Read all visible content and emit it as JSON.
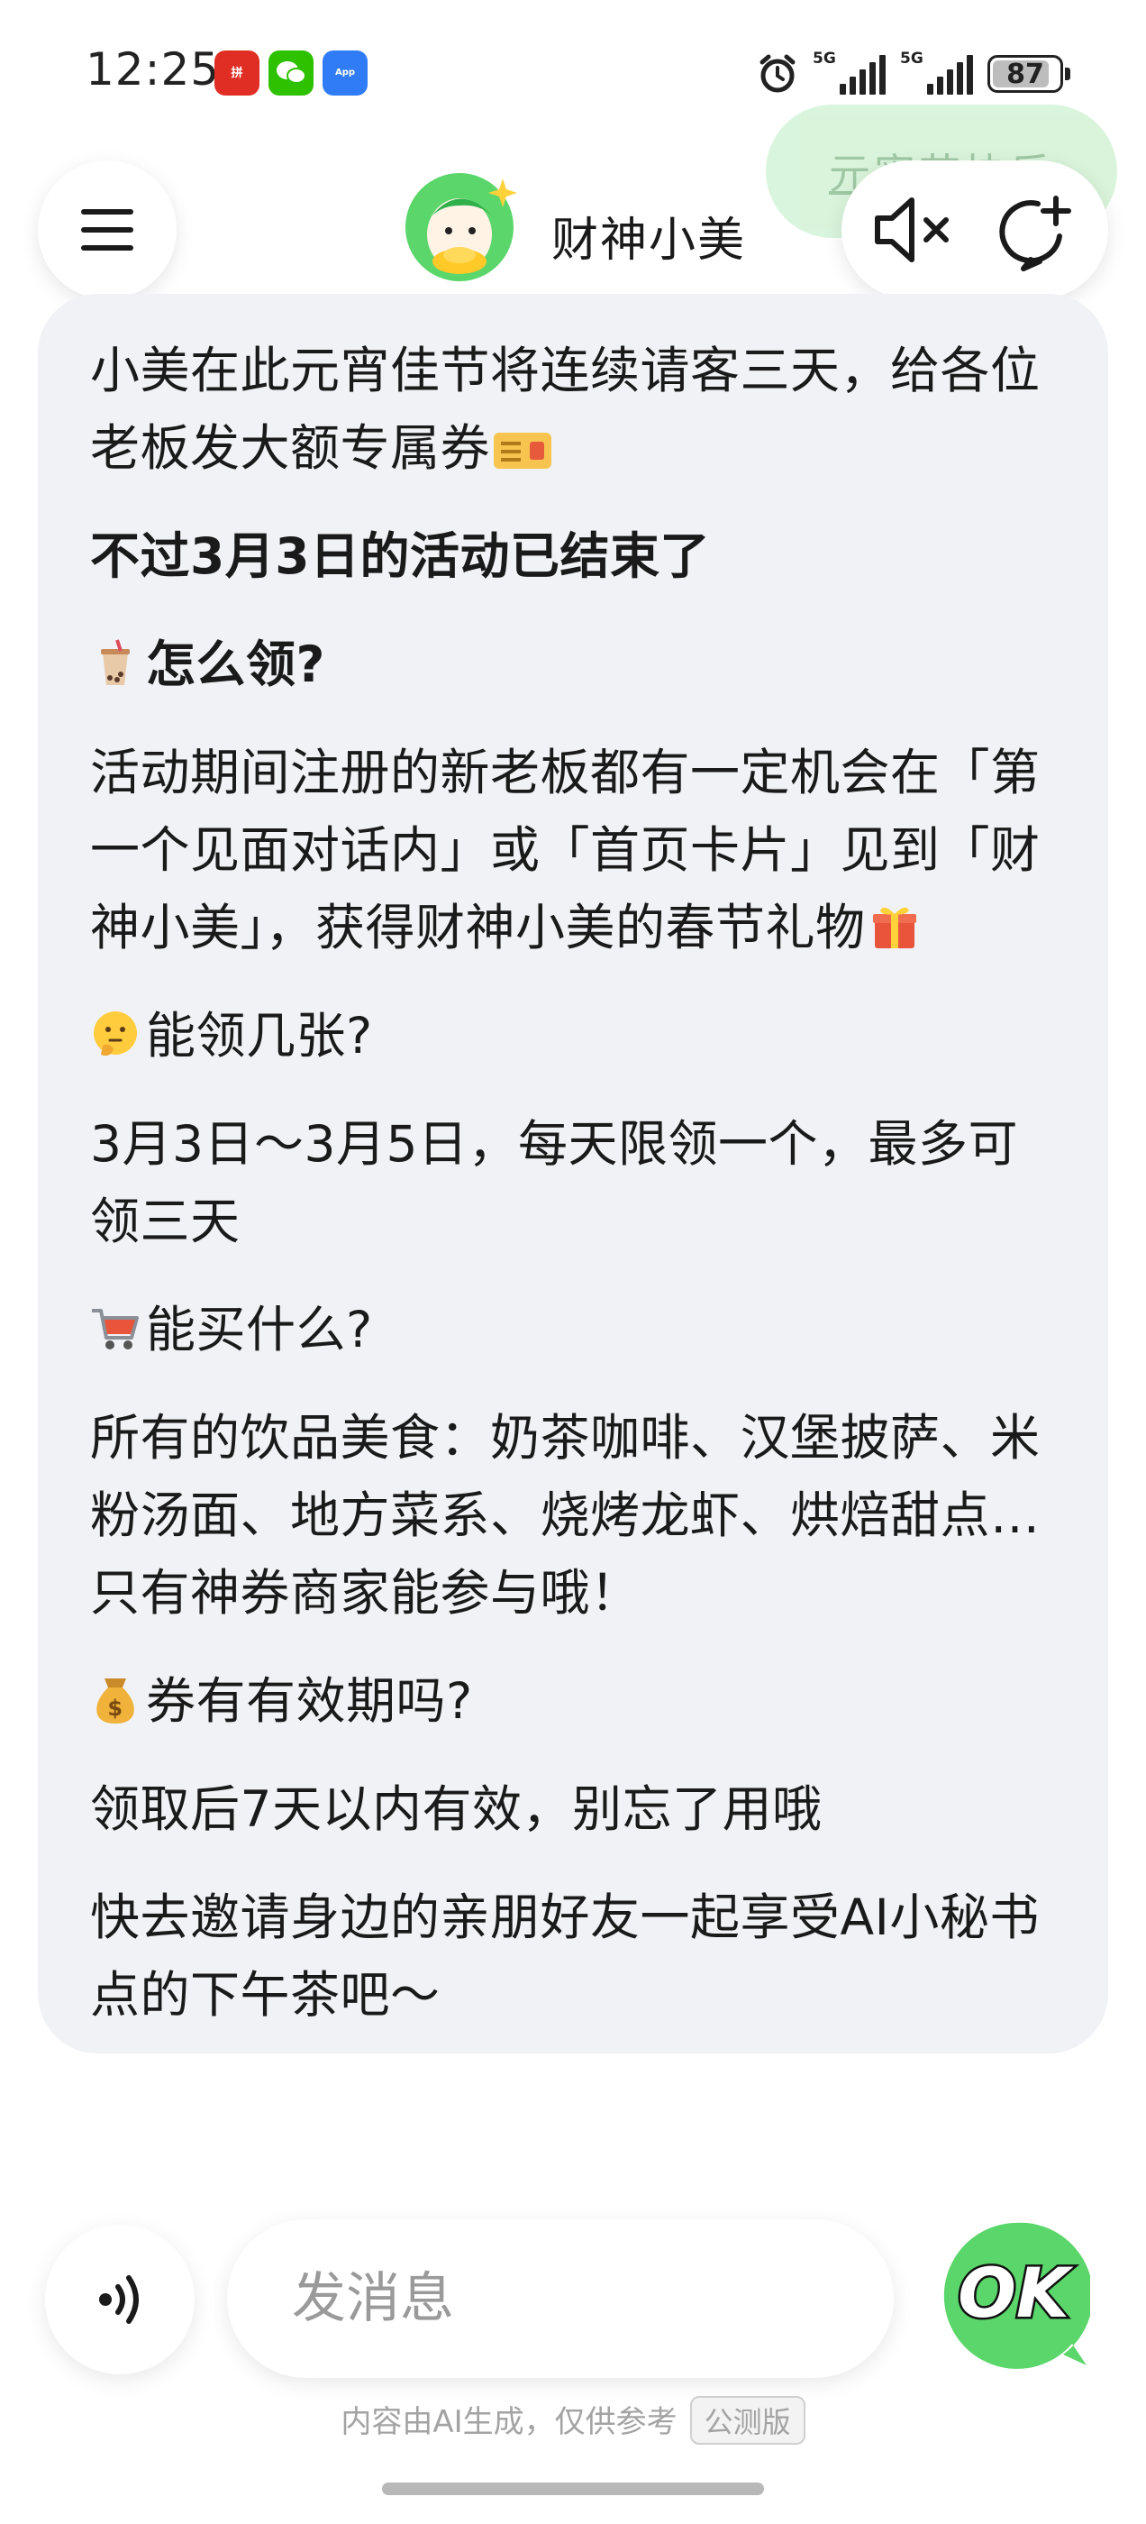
{
  "status_bar": {
    "time": "12:25",
    "apps": [
      {
        "name": "pinduoduo",
        "glyph": "拼"
      },
      {
        "name": "wechat",
        "glyph": "💬"
      },
      {
        "name": "app-market",
        "glyph": "App"
      }
    ],
    "network_1": "5G",
    "network_2": "5G",
    "battery": "87",
    "battery_level": 0.87
  },
  "header": {
    "festival_bubble": "元宵节快乐",
    "bot_name": "财神小美"
  },
  "message": {
    "p1": "小美在此元宵佳节将连续请客三天，给各位老板发大额专属券",
    "p2": "不过3月3日的活动已结束了",
    "h1": "怎么领?",
    "p3": "活动期间注册的新老板都有一定机会在「第一个见面对话内」或「首页卡片」见到「财神小美」，获得财神小美的春节礼物",
    "h2": "能领几张?",
    "p4": "3月3日～3月5日，每天限领一个，最多可领三天",
    "h3": "能买什么?",
    "p5": "所有的饮品美食：奶茶咖啡、汉堡披萨、米粉汤面、地方菜系、烧烤龙虾、烘焙甜点…只有神券商家能参与哦！",
    "h4": "券有有效期吗?",
    "p6": "领取后7天以内有效，别忘了用哦",
    "p7": "快去邀请身边的亲朋好友一起享受AI小秘书点的下午茶吧～"
  },
  "input": {
    "placeholder": "发消息",
    "send_label": "OK"
  },
  "footer": {
    "disclaimer": "内容由AI生成，仅供参考",
    "badge": "公测版"
  },
  "colors": {
    "card_bg": "#f1f2f6",
    "accent_green": "#5ad66a",
    "festival_bubble_bg": "#d4f3d7"
  },
  "icons": [
    "menu-icon",
    "mute-icon",
    "new-chat-icon",
    "voice-icon",
    "alarm-icon",
    "coupon-icon",
    "bubble-tea-icon",
    "gift-icon",
    "thinking-face-icon",
    "cart-icon",
    "money-bag-icon"
  ]
}
